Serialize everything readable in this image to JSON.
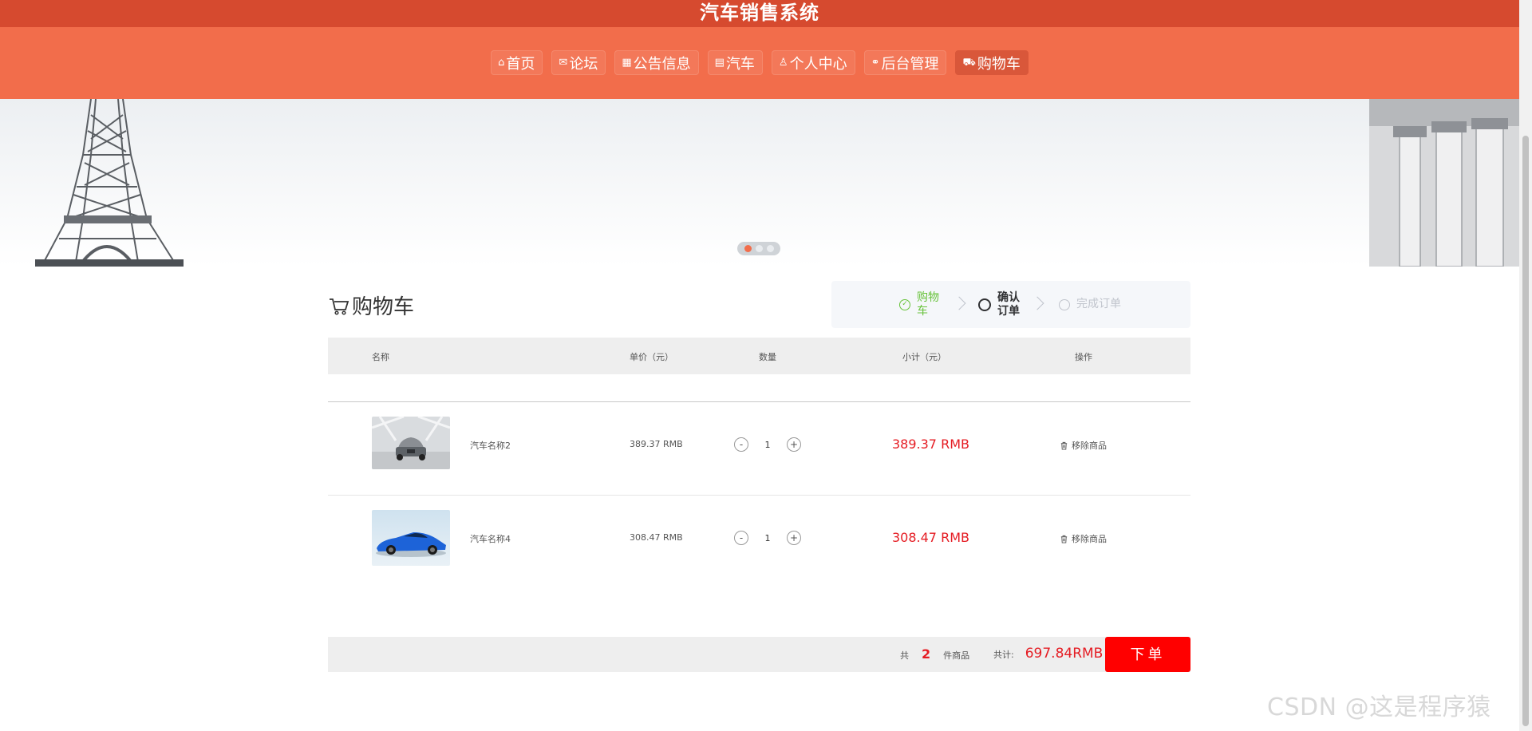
{
  "header": {
    "title": "汽车销售系统",
    "nav": [
      {
        "icon": "home-icon",
        "glyph": "⌂",
        "label": "首页"
      },
      {
        "icon": "mail-icon",
        "glyph": "✉",
        "label": "论坛"
      },
      {
        "icon": "notice-icon",
        "glyph": "▦",
        "label": "公告信息"
      },
      {
        "icon": "document-icon",
        "glyph": "▤",
        "label": "汽车"
      },
      {
        "icon": "user-icon",
        "glyph": "♙",
        "label": "个人中心"
      },
      {
        "icon": "link-icon",
        "glyph": "⚭",
        "label": "后台管理"
      },
      {
        "icon": "cart-icon",
        "glyph": "⛟",
        "label": "购物车",
        "active": true
      }
    ]
  },
  "banner": {
    "active_slide": 0,
    "slides": 3
  },
  "cart": {
    "title": "购物车",
    "steps": [
      {
        "label": "购物车",
        "state": "done",
        "glyph": "✓"
      },
      {
        "label": "确认订单",
        "state": "current",
        "glyph": ""
      },
      {
        "label": "完成订单",
        "state": "pending",
        "glyph": ""
      }
    ],
    "columns": [
      "名称",
      "单价（元）",
      "数量",
      "小计（元）",
      "操作"
    ],
    "items": [
      {
        "name": "汽车名称2",
        "price": "389.37 RMB",
        "qty": "1",
        "subtotal": "389.37 RMB",
        "remove": "移除商品",
        "minus": "-",
        "plus": "+"
      },
      {
        "name": "汽车名称4",
        "price": "308.47 RMB",
        "qty": "1",
        "subtotal": "308.47 RMB",
        "remove": "移除商品",
        "minus": "-",
        "plus": "+"
      }
    ],
    "footer": {
      "prefix": "共",
      "count": "2",
      "suffix": "件商品",
      "total_label": "共计:",
      "total": "697.84RMB",
      "order_button": "下单"
    }
  },
  "watermark": "CSDN @这是程序猿",
  "colors": {
    "header": "#f26d4b",
    "title_bar": "#d64a2f",
    "price_red": "#e51c23",
    "order_button": "#ff0000",
    "step_done": "#67c23a"
  }
}
